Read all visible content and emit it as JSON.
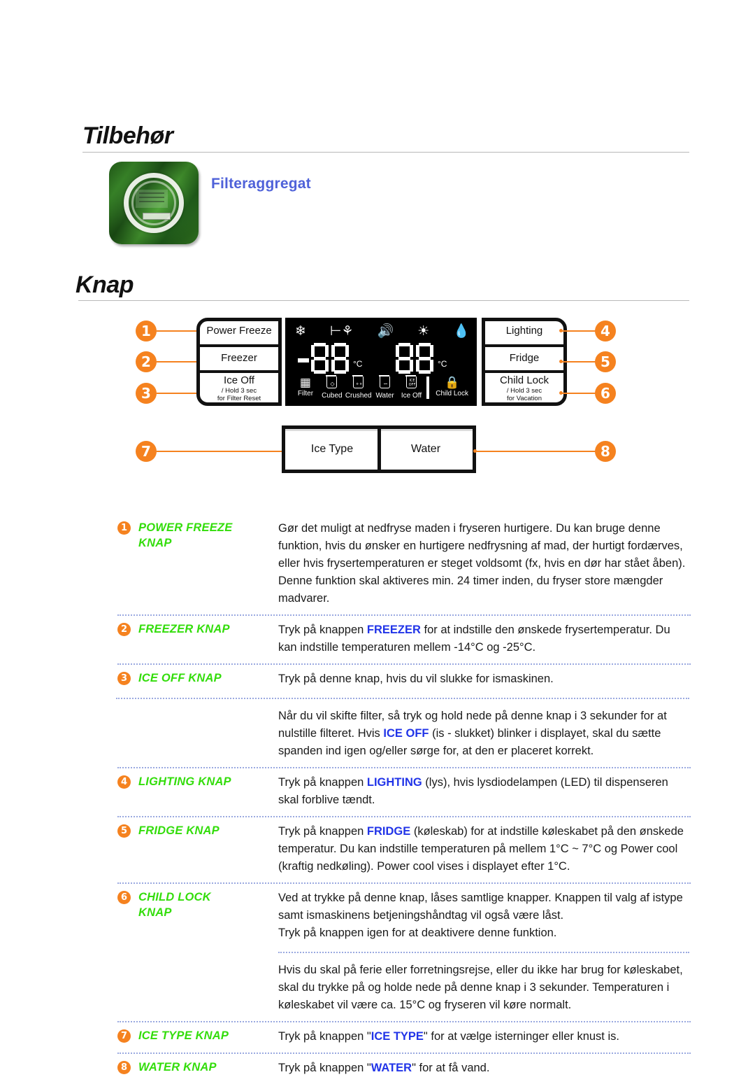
{
  "document": {
    "sections": [
      {
        "id": "tilbehor",
        "title": "Tilbehør"
      },
      {
        "id": "knap",
        "title": "Knap"
      }
    ]
  },
  "accessory": {
    "caption": "Filteraggregat",
    "thumbnail_alt": "filter-kit-package"
  },
  "diagram": {
    "left_buttons": [
      {
        "number": "1",
        "label": "Power Freeze",
        "sub": ""
      },
      {
        "number": "2",
        "label": "Freezer",
        "sub": ""
      },
      {
        "number": "3",
        "label": "Ice Off",
        "sub": "/ Hold 3 sec\nfor Filter Reset",
        "sub_line1": "/ Hold 3 sec",
        "sub_line2": "for Filter Reset"
      }
    ],
    "right_buttons": [
      {
        "number": "4",
        "label": "Lighting",
        "sub_line1": "",
        "sub_line2": ""
      },
      {
        "number": "5",
        "label": "Fridge",
        "sub_line1": "",
        "sub_line2": ""
      },
      {
        "number": "6",
        "label": "Child Lock",
        "sub_line1": "/ Hold 3 sec",
        "sub_line2": "for Vacation"
      }
    ],
    "bottom_module": [
      {
        "number": "7",
        "label": "Ice Type"
      },
      {
        "number": "8",
        "label": "Water"
      }
    ],
    "display": {
      "top_icons": [
        "snowflake-icon",
        "plug-energy-saving-icon",
        "speaker-sound-icon",
        "light-bulb-icon",
        "water-drop-snowflake-icon"
      ],
      "freezer_reading": {
        "sign": "-",
        "digits": "88",
        "unit": "°C"
      },
      "fridge_reading": {
        "sign": "",
        "digits": "88",
        "unit": "°C"
      },
      "status_icons": [
        {
          "icon": "filter-icon",
          "label": "Filter"
        },
        {
          "icon": "cubed-ice-glass-icon",
          "label": "Cubed"
        },
        {
          "icon": "crushed-ice-glass-icon",
          "label": "Crushed"
        },
        {
          "icon": "water-glass-icon",
          "label": "Water"
        },
        {
          "icon": "ice-off-glass-icon",
          "label": "Ice Off"
        },
        {
          "icon": "padlock-icon",
          "label": "Child Lock"
        }
      ]
    }
  },
  "descriptions": [
    {
      "number": "1",
      "term_line1": "POWER FREEZE",
      "term_line2": "KNAP",
      "paragraphs": [
        "Gør det muligt at nedfryse maden i fryseren hurtigere. Du kan bruge denne funktion, hvis du ønsker en hurtigere nedfrysning af mad, der hurtigt fordærves, eller hvis frysertemperaturen er steget voldsomt (fx, hvis en dør har stået åben). Denne funktion skal aktiveres min. 24 timer inden, du fryser store mængder madvarer."
      ]
    },
    {
      "number": "2",
      "term_line1": "FREEZER KNAP",
      "term_line2": "",
      "paragraphs": [
        "Tryk på knappen |FREEZER| for at indstille den ønskede frysertemperatur. Du kan indstille temperaturen mellem -14°C og -25°C."
      ]
    },
    {
      "number": "3",
      "term_line1": "ICE OFF KNAP",
      "term_line2": "",
      "paragraphs": [
        "Tryk på denne knap, hvis du vil slukke for ismaskinen.",
        "Når du vil skifte filter, så tryk og hold nede på denne knap i 3 sekunder for at nulstille filteret. Hvis |ICE OFF| (is - slukket) blinker i displayet, skal du sætte spanden ind igen og/eller sørge for, at den er placeret korrekt."
      ]
    },
    {
      "number": "4",
      "term_line1": "LIGHTING KNAP",
      "term_line2": "",
      "paragraphs": [
        "Tryk på knappen |LIGHTING| (lys), hvis lysdiodelampen (LED) til dispenseren skal forblive tændt."
      ]
    },
    {
      "number": "5",
      "term_line1": "FRIDGE KNAP",
      "term_line2": "",
      "paragraphs": [
        "Tryk på knappen |FRIDGE| (køleskab) for at indstille køleskabet på den ønskede temperatur. Du kan indstille temperaturen på mellem 1°C ~ 7°C og Power cool (kraftig nedkøling). Power cool vises i displayet efter 1°C."
      ]
    },
    {
      "number": "6",
      "term_line1": "CHILD LOCK",
      "term_line2": "KNAP",
      "paragraphs": [
        "Ved at trykke på denne knap, låses samtlige knapper. Knappen til valg af istype samt ismaskinens betjeningshåndtag vil også være låst.\nTryk på knappen igen for at deaktivere denne funktion.",
        "Hvis du skal på ferie eller forretningsrejse, eller du ikke har brug for køleskabet, skal du trykke på og holde nede på denne knap i 3 sekunder. Temperaturen i køleskabet vil være ca. 15°C og fryseren vil køre normalt."
      ]
    },
    {
      "number": "7",
      "term_line1": "ICE TYPE KNAP",
      "term_line2": "",
      "paragraphs": [
        "Tryk på knappen \"|ICE TYPE|\" for at vælge isterninger eller knust is."
      ]
    },
    {
      "number": "8",
      "term_line1": "WATER KNAP",
      "term_line2": "",
      "paragraphs": [
        "Tryk på knappen \"|WATER|\" for at få vand."
      ]
    }
  ],
  "colors": {
    "accent_orange": "#f5821f",
    "term_green": "#33dd0b",
    "highlight_blue": "#2134e8",
    "caption_blue": "#4f62d9",
    "divider_blue": "#9aa9e0"
  }
}
